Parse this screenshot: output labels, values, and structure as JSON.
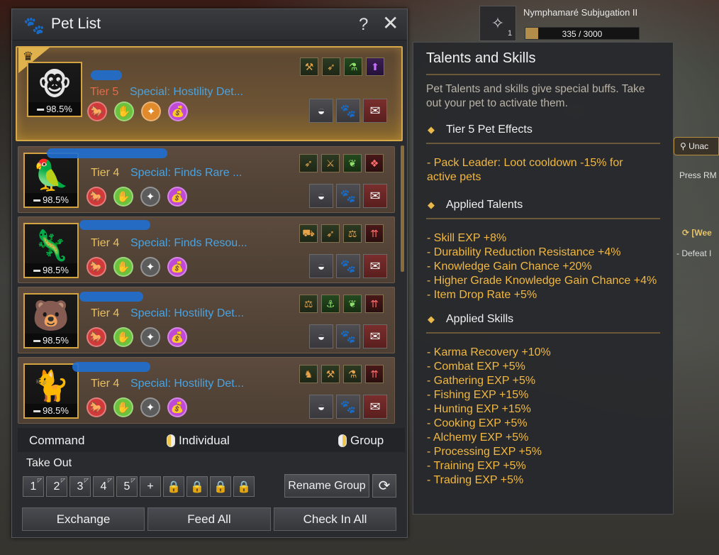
{
  "background": {
    "quest_title": "Nymphamaré Subjugation II",
    "quest_count": "1",
    "quest_progress": "335 / 3000",
    "quest_progress_fraction": 0.11,
    "side_tab": "Unac",
    "side_hint": "Press RM",
    "side_quest": "[Wee",
    "side_quest_sub": "- Defeat I"
  },
  "window": {
    "title": "Pet List",
    "help_glyph": "?",
    "close_glyph": "✕"
  },
  "pets": [
    {
      "tier": "Tier 5",
      "special": "Special: Hostility Det...",
      "hunger": "98.5%",
      "leader": true,
      "art": "🐵"
    },
    {
      "tier": "Tier 4",
      "special": "Special: Finds Rare ...",
      "hunger": "98.5%",
      "leader": false,
      "art": "🦜"
    },
    {
      "tier": "Tier 4",
      "special": "Special: Finds Resou...",
      "hunger": "98.5%",
      "leader": false,
      "art": "🦎"
    },
    {
      "tier": "Tier 4",
      "special": "Special: Hostility Det...",
      "hunger": "98.5%",
      "leader": false,
      "art": "🐻"
    },
    {
      "tier": "Tier 4",
      "special": "Special: Hostility Det...",
      "hunger": "98.5%",
      "leader": false,
      "art": "🐈"
    }
  ],
  "command": {
    "label": "Command",
    "individual": "Individual",
    "group": "Group"
  },
  "takeout": {
    "label": "Take Out",
    "slots": [
      "1",
      "2",
      "3",
      "4",
      "5",
      "+"
    ],
    "locked_count": 4
  },
  "buttons": {
    "rename_group": "Rename Group",
    "exchange": "Exchange",
    "feed_all": "Feed All",
    "check_in_all": "Check In All"
  },
  "tooltip": {
    "title": "Talents and Skills",
    "description": "Pet Talents and skills give special buffs. Take out your pet to activate them.",
    "tier5_heading": "Tier 5 Pet Effects",
    "tier5_effects": [
      "- Pack Leader: Loot cooldown -15% for",
      "active pets"
    ],
    "talents_heading": "Applied Talents",
    "talents": [
      "- Skill EXP +8%",
      "- Durability Reduction Resistance +4%",
      "- Knowledge Gain Chance +20%",
      "- Higher Grade Knowledge Gain Chance +4%",
      "- Item Drop Rate +5%"
    ],
    "skills_heading": "Applied Skills",
    "skills": [
      "- Karma Recovery +10%",
      "- Combat EXP +5%",
      "- Gathering EXP +5%",
      "- Fishing EXP +15%",
      "- Hunting EXP +15%",
      "- Cooking EXP +5%",
      "- Alchemy EXP +5%",
      "- Processing EXP +5%",
      "- Training EXP +5%",
      "- Trading EXP +5%"
    ]
  },
  "colors": {
    "tier5": "#e36b4a",
    "tier4": "#e9c060",
    "special": "#4aa3e0",
    "tooltip_value": "#f2b840",
    "leader_border": "#d7a84a"
  }
}
